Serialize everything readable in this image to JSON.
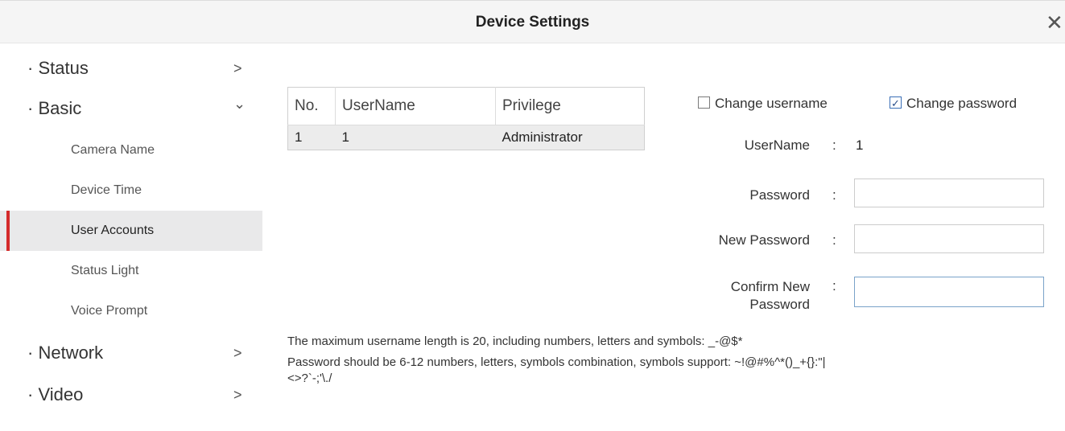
{
  "window": {
    "title": "Device Settings",
    "close_icon": "close-icon"
  },
  "sidebar": {
    "sections": [
      {
        "label": "Status",
        "chevron": ">"
      },
      {
        "label": "Basic",
        "chevron": "⌄"
      },
      {
        "label": "Network",
        "chevron": ">"
      },
      {
        "label": "Video",
        "chevron": ">"
      }
    ],
    "sub_items": [
      {
        "label": "Camera Name"
      },
      {
        "label": "Device Time"
      },
      {
        "label": "User Accounts",
        "active": true
      },
      {
        "label": "Status Light"
      },
      {
        "label": "Voice Prompt"
      }
    ],
    "accent_color": "#d42a2a"
  },
  "user_table": {
    "headers": [
      "No.",
      "UserName",
      "Privilege"
    ],
    "rows": [
      [
        "1",
        "1",
        "Administrator"
      ]
    ]
  },
  "form": {
    "change_username": {
      "label": "Change username",
      "checked": false
    },
    "change_password": {
      "label": "Change password",
      "checked": true
    },
    "username_label": "UserName",
    "username_value": "1",
    "password_label": "Password",
    "new_password_label": "New Password",
    "confirm_label_line1": "Confirm New",
    "confirm_label_line2": "Password",
    "colon": ":",
    "password_value": "",
    "new_password_value": "",
    "confirm_password_value": ""
  },
  "notes": {
    "username_rule": "The maximum username length is 20, including numbers, letters and symbols: _-@$*",
    "password_rule_line1": "Password should be 6-12 numbers, letters, symbols combination, symbols support: ~!@#%^*()_+{}:\"|",
    "password_rule_line2": "<>?`-;'\\./"
  }
}
